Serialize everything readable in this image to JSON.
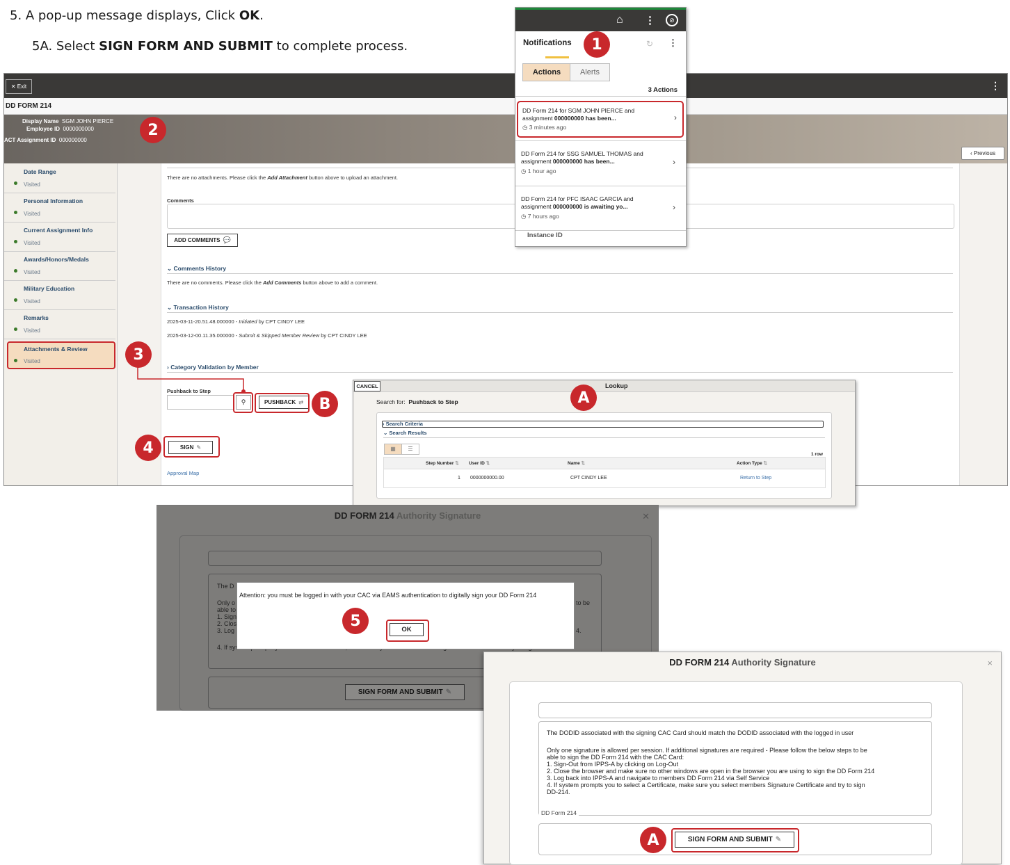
{
  "instructions": {
    "step5_prefix": "5. A pop-up message displays, Click ",
    "step5_bold": "OK",
    "step5_suffix": ".",
    "step5a_prefix": "5A. Select ",
    "step5a_bold": "SIGN FORM AND SUBMIT",
    "step5a_suffix": " to complete process."
  },
  "badges": {
    "one": "1",
    "two": "2",
    "three": "3",
    "four": "4",
    "five": "5",
    "a_lookup": "A",
    "b": "B",
    "a_submit": "A"
  },
  "colors": {
    "badge": "#c8282c",
    "topbar": "#3a3937",
    "link": "#2a4b6b",
    "visited_dot": "#3b7a2a",
    "active_item": "#f5dcbf",
    "green_accent": "#1d8a3a"
  },
  "main": {
    "exit_label": "✕ Exit",
    "menu_icon": "⋮",
    "form_title": "DD FORM 214",
    "header": {
      "display_name_label": "Display Name",
      "display_name_value": "SGM JOHN PIERCE",
      "employee_id_label": "Employee ID",
      "employee_id_value": "0000000000",
      "assignment_id_label": "ACT Assignment ID",
      "assignment_id_value": "000000000"
    },
    "previous_label": "‹ Previous",
    "sidebar": [
      {
        "label": "Date Range",
        "status": "Visited"
      },
      {
        "label": "Personal Information",
        "status": "Visited"
      },
      {
        "label": "Current Assignment Info",
        "status": "Visited"
      },
      {
        "label": "Awards/Honors/Medals",
        "status": "Visited"
      },
      {
        "label": "Military Education",
        "status": "Visited"
      },
      {
        "label": "Remarks",
        "status": "Visited"
      },
      {
        "label": "Attachments & Review",
        "status": "Visited"
      }
    ],
    "content": {
      "no_attachments_pre": "There are no attachments. Please click the ",
      "no_attachments_em": "Add Attachment",
      "no_attachments_post": " button above to upload an attachment.",
      "comments_label": "Comments",
      "add_comments_label": "ADD COMMENTS",
      "comments_history_label": "Comments History",
      "no_comments_pre": "There are no comments. Please click the ",
      "no_comments_em": "Add Comments",
      "no_comments_post": " button above to add a comment.",
      "transaction_history_label": "Transaction History",
      "tx1_time": "2025-03-11-20.51.48.000000 - ",
      "tx1_action": "Initiated",
      "tx1_by": " by CPT CINDY LEE",
      "tx2_time": "2025-03-12-00.11.35.000000 - ",
      "tx2_action": "Submit & Skipped Member Review",
      "tx2_by": " by CPT CINDY LEE",
      "category_validation_label": "Category Validation by Member",
      "pushback_step_label": "Pushback to Step",
      "pushback_label": "PUSHBACK",
      "sign_label": "SIGN",
      "approval_map_label": "Approval Map"
    }
  },
  "notifications": {
    "title": "Notifications",
    "tab_actions": "Actions",
    "tab_alerts": "Alerts",
    "count": "3 Actions",
    "items": [
      {
        "line1": "DD Form 214 for SGM JOHN PIERCE and",
        "line2_pre": "assignment ",
        "line2_bold": "000000000 has been...",
        "time": "3 minutes ago"
      },
      {
        "line1": "DD Form 214 for SSG SAMUEL THOMAS and",
        "line2_pre": "assignment ",
        "line2_bold": "000000000 has been...",
        "time": "1 hour ago"
      },
      {
        "line1": "DD Form 214 for PFC ISAAC GARCIA and",
        "line2_pre": "assignment ",
        "line2_bold": "000000000 is awaiting yo...",
        "time": "7 hours ago"
      }
    ],
    "instance_id_label": "Instance ID"
  },
  "lookup": {
    "cancel_label": "CANCEL",
    "title": "Lookup",
    "search_for_label": "Search for:",
    "search_for_value": "Pushback to Step",
    "search_criteria_label": "Search Criteria",
    "search_results_label": "Search Results",
    "row_count": "1 row",
    "columns": [
      "Step Number",
      "User ID",
      "Name",
      "Action Type"
    ],
    "rows": [
      [
        "1",
        "0000000000.00",
        "CPT CINDY LEE",
        "Return to Step"
      ]
    ]
  },
  "signature_dialog_bg": {
    "title_prefix": "DD FORM 214",
    "title_suffix": " Authority Signature",
    "text_fragments": [
      "The D",
      "Only o",
      "able to",
      "1. Sign",
      "2. Clos",
      "3. Log",
      "4. If system prompts you to select a Certificate, make sure you select members Signature Certificate and try to sign",
      "DD-214.",
      "to be",
      "4."
    ],
    "submit_label": "SIGN FORM AND SUBMIT"
  },
  "attention": {
    "message": "Attention: you must be logged in with your CAC via EAMS authentication to digitally sign your DD Form 214",
    "ok_label": "OK"
  },
  "signature_dialog": {
    "title_prefix": "DD FORM 214",
    "title_suffix": " Authority Signature",
    "close": "×",
    "dodid_note": "The DODID associated with the signing CAC Card should match the DODID associated with the logged in user",
    "para1": "Only one signature is allowed per session. If additional signatures are required - Please follow the below steps to be",
    "para2": "able to sign the DD Form 214 with the CAC Card:",
    "step1": "1. Sign-Out from IPPS-A by clicking on Log-Out",
    "step2": "2. Close the browser and make sure no other windows are open in the browser you are using to sign the DD Form 214",
    "step3": "3. Log back into IPPS-A and navigate to members DD Form 214 via Self Service",
    "step4": "4. If system prompts you to select a Certificate, make sure you select members Signature Certificate and try to sign",
    "step4b": "DD-214.",
    "legend": "DD Form 214",
    "submit_label": "SIGN FORM AND SUBMIT"
  }
}
